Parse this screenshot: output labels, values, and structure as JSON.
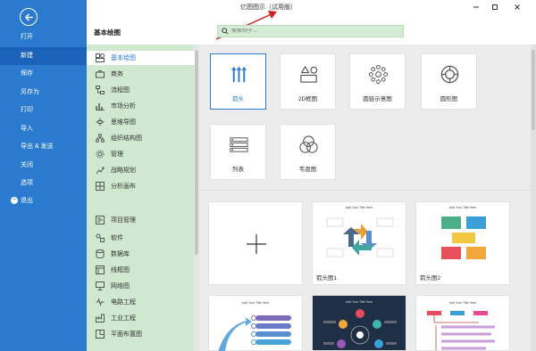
{
  "window": {
    "title": "亿图图示（试用版）"
  },
  "sidebar": {
    "items": [
      {
        "label": "打开"
      },
      {
        "label": "新建"
      },
      {
        "label": "保存"
      },
      {
        "label": "另存为"
      },
      {
        "label": "打印"
      },
      {
        "label": "导入"
      },
      {
        "label": "导出 & 发送"
      },
      {
        "label": "关闭"
      },
      {
        "label": "选项"
      },
      {
        "label": "退出"
      }
    ]
  },
  "main": {
    "section_title": "基本绘图",
    "search_placeholder": "搜索例子..."
  },
  "categories": [
    {
      "label": "基本绘图"
    },
    {
      "label": "商务"
    },
    {
      "label": "流程图"
    },
    {
      "label": "市场分析"
    },
    {
      "label": "思维导图"
    },
    {
      "label": "组织结构图"
    },
    {
      "label": "管理"
    },
    {
      "label": "战略规划"
    },
    {
      "label": "分析画布"
    },
    {
      "label": "项目管理"
    },
    {
      "label": "软件"
    },
    {
      "label": "数据库"
    },
    {
      "label": "线框图"
    },
    {
      "label": "网络图"
    },
    {
      "label": "电路工程"
    },
    {
      "label": "工业工程"
    },
    {
      "label": "平面布置图"
    }
  ],
  "tiles": [
    {
      "label": "箭头",
      "icon": "arrows-icon"
    },
    {
      "label": "2D框图",
      "icon": "shapes-2d-icon"
    },
    {
      "label": "圆链示意图",
      "icon": "circular-chain-icon"
    },
    {
      "label": "圆形图",
      "icon": "circle-diagram-icon"
    },
    {
      "label": "列表",
      "icon": "list-icon"
    },
    {
      "label": "韦恩图",
      "icon": "venn-icon"
    }
  ],
  "templates": [
    {
      "caption": "",
      "thumb_title": ""
    },
    {
      "caption": "箭头图1",
      "thumb_title": "Add Your Title Here"
    },
    {
      "caption": "箭头图2",
      "thumb_title": "Add Your Title Here"
    },
    {
      "caption": "",
      "thumb_title": "Add Your Title Here"
    },
    {
      "caption": "",
      "thumb_title": "Add Your Title Here"
    },
    {
      "caption": "",
      "thumb_title": "Add Your Title Here"
    }
  ],
  "colors": {
    "sidebar": "#2a7ad0",
    "sidebar_active": "#1b63b8",
    "category_bg": "#cfe8cf",
    "search_bg": "#d3ecd3",
    "accent": "#2a7ad0",
    "annotation_arrow": "#d02020"
  }
}
